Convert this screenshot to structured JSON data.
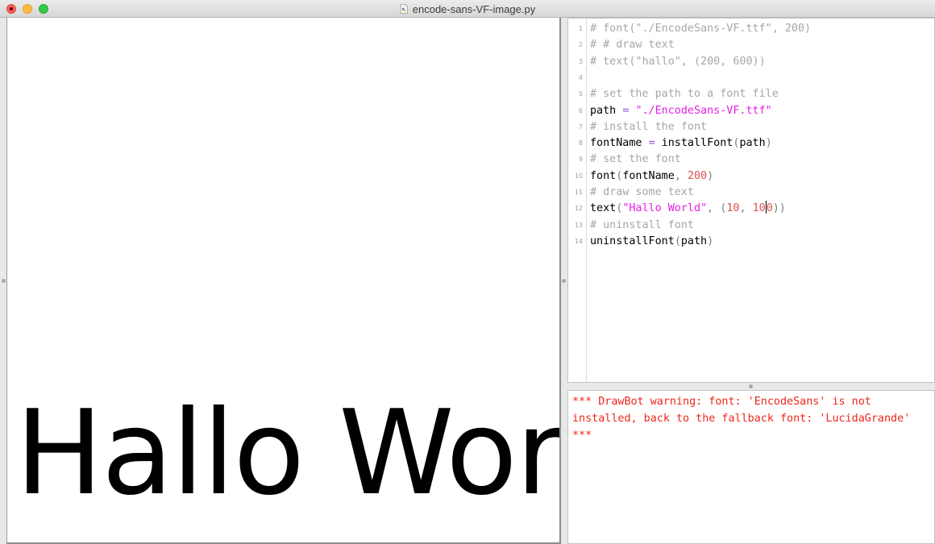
{
  "window": {
    "title": "encode-sans-VF-image.py"
  },
  "canvas": {
    "rendered_text": "Hallo World"
  },
  "editor": {
    "lines": [
      {
        "n": "1",
        "segments": [
          {
            "t": "# font(\"./EncodeSans-VF.ttf\", 200)",
            "c": "comment"
          }
        ]
      },
      {
        "n": "2",
        "segments": [
          {
            "t": "# # draw text",
            "c": "comment"
          }
        ]
      },
      {
        "n": "3",
        "segments": [
          {
            "t": "# text(\"hallo\", (200, 600))",
            "c": "comment"
          }
        ]
      },
      {
        "n": "4",
        "segments": []
      },
      {
        "n": "5",
        "segments": [
          {
            "t": "# set the path to a font file",
            "c": "comment"
          }
        ]
      },
      {
        "n": "6",
        "segments": [
          {
            "t": "path ",
            "c": "plain"
          },
          {
            "t": "=",
            "c": "op"
          },
          {
            "t": " ",
            "c": "plain"
          },
          {
            "t": "\"./EncodeSans-VF.ttf\"",
            "c": "string"
          }
        ]
      },
      {
        "n": "7",
        "segments": [
          {
            "t": "# install the font",
            "c": "comment"
          }
        ]
      },
      {
        "n": "8",
        "segments": [
          {
            "t": "fontName ",
            "c": "plain"
          },
          {
            "t": "=",
            "c": "op"
          },
          {
            "t": " installFont",
            "c": "plain"
          },
          {
            "t": "(",
            "c": "paren"
          },
          {
            "t": "path",
            "c": "plain"
          },
          {
            "t": ")",
            "c": "paren"
          }
        ]
      },
      {
        "n": "9",
        "segments": [
          {
            "t": "# set the font",
            "c": "comment"
          }
        ]
      },
      {
        "n": "10",
        "segments": [
          {
            "t": "font",
            "c": "plain"
          },
          {
            "t": "(",
            "c": "paren"
          },
          {
            "t": "fontName",
            "c": "plain"
          },
          {
            "t": ", ",
            "c": "paren"
          },
          {
            "t": "200",
            "c": "number"
          },
          {
            "t": ")",
            "c": "paren"
          }
        ]
      },
      {
        "n": "11",
        "segments": [
          {
            "t": "# draw some text",
            "c": "comment"
          }
        ]
      },
      {
        "n": "12",
        "segments": [
          {
            "t": "text",
            "c": "plain"
          },
          {
            "t": "(",
            "c": "paren"
          },
          {
            "t": "\"Hallo World\"",
            "c": "string"
          },
          {
            "t": ", (",
            "c": "paren"
          },
          {
            "t": "10",
            "c": "number"
          },
          {
            "t": ", ",
            "c": "paren"
          },
          {
            "t": "10",
            "c": "number"
          },
          {
            "t": "",
            "c": "caret"
          },
          {
            "t": "0",
            "c": "number"
          },
          {
            "t": "))",
            "c": "paren"
          }
        ]
      },
      {
        "n": "13",
        "segments": [
          {
            "t": "# uninstall font",
            "c": "comment"
          }
        ]
      },
      {
        "n": "14",
        "segments": [
          {
            "t": "uninstallFont",
            "c": "plain"
          },
          {
            "t": "(",
            "c": "paren"
          },
          {
            "t": "path",
            "c": "plain"
          },
          {
            "t": ")",
            "c": "paren"
          }
        ]
      }
    ]
  },
  "console": {
    "output": "*** DrawBot warning: font: 'EncodeSans' is not\ninstalled, back to the fallback font: 'LucidaGrande'\n***"
  },
  "colors": {
    "comment": "#a6a6a6",
    "string": "#e51ee5",
    "number": "#d9534f",
    "operator": "#8b50d0",
    "warning": "#f0251c"
  }
}
